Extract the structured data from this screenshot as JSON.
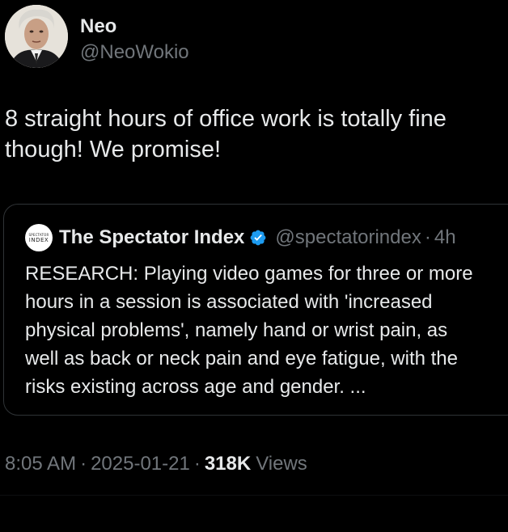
{
  "author": {
    "display_name": "Neo",
    "handle": "@NeoWokio",
    "avatar_icon": "profile-photo"
  },
  "tweet": {
    "text": "8 straight hours of office work is totally fine\nthough! We promise!"
  },
  "quoted_tweet": {
    "logo_line1": "SPECTATOR",
    "logo_line2": "INDEX",
    "display_name": "The Spectator Index",
    "verified_icon": "verified-badge-icon",
    "handle": "@spectatorindex",
    "separator": "·",
    "time": "4h",
    "text": "RESEARCH: Playing video games for three or more\nhours in a session is associated with 'increased\nphysical problems', namely hand or wrist pain, as\nwell as back or neck pain and eye fatigue, with the\nrisks existing across age and gender. ..."
  },
  "meta": {
    "time": "8:05 AM",
    "separator": "·",
    "date": "2025-01-21",
    "views_count": "318K",
    "views_label": "Views"
  },
  "colors": {
    "background": "#000000",
    "primary_text": "#e7e9ea",
    "secondary_text": "#71767b",
    "border": "#2f3336",
    "verified": "#1d9bf0"
  }
}
